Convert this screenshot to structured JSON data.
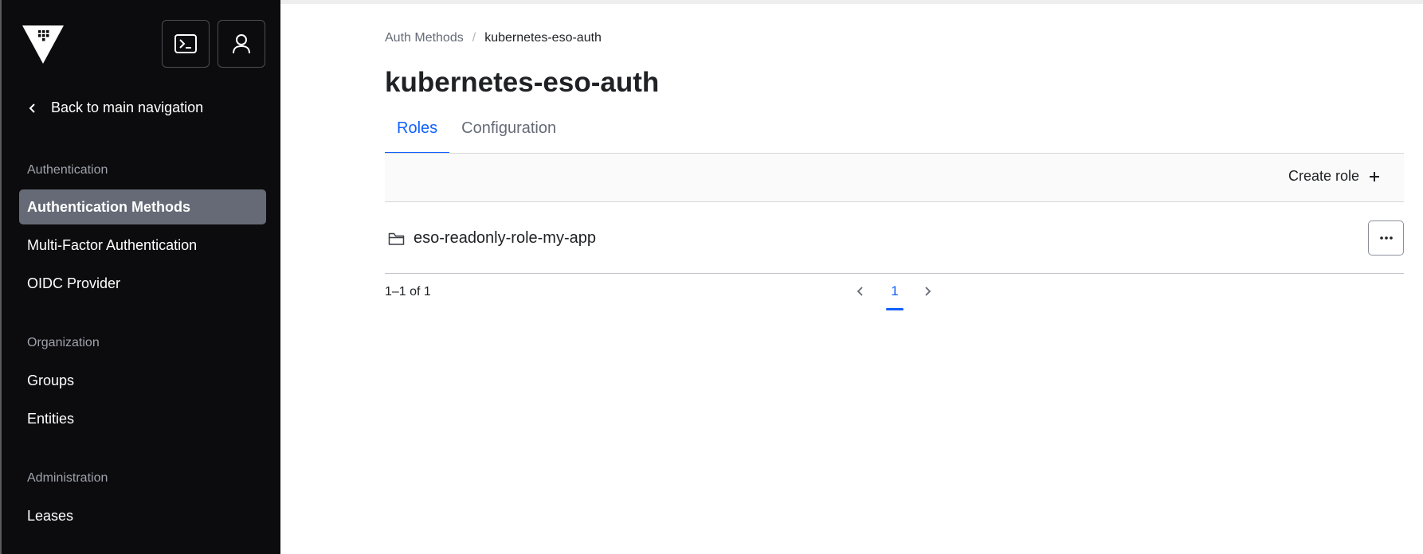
{
  "sidebar": {
    "logo_icon": "vault-logo-icon",
    "console_icon": "terminal-icon",
    "user_icon": "user-icon",
    "back_label": "Back to main navigation",
    "sections": [
      {
        "title": "Authentication",
        "items": [
          {
            "label": "Authentication Methods",
            "active": true
          },
          {
            "label": "Multi-Factor Authentication",
            "active": false
          },
          {
            "label": "OIDC Provider",
            "active": false
          }
        ]
      },
      {
        "title": "Organization",
        "items": [
          {
            "label": "Groups",
            "active": false
          },
          {
            "label": "Entities",
            "active": false
          }
        ]
      },
      {
        "title": "Administration",
        "items": [
          {
            "label": "Leases",
            "active": false
          }
        ]
      }
    ]
  },
  "breadcrumb": {
    "parent": "Auth Methods",
    "separator": "/",
    "current": "kubernetes-eso-auth"
  },
  "page": {
    "title": "kubernetes-eso-auth"
  },
  "tabs": [
    {
      "label": "Roles",
      "active": true
    },
    {
      "label": "Configuration",
      "active": false
    }
  ],
  "toolbar": {
    "create_label": "Create role"
  },
  "roles": [
    {
      "name": "eso-readonly-role-my-app",
      "icon": "folder-icon"
    }
  ],
  "pagination": {
    "summary": "1–1 of 1",
    "current_page": "1"
  },
  "colors": {
    "accent": "#1060ff",
    "sidebar_bg": "#0c0c0e",
    "active_nav_bg": "#656a76"
  }
}
